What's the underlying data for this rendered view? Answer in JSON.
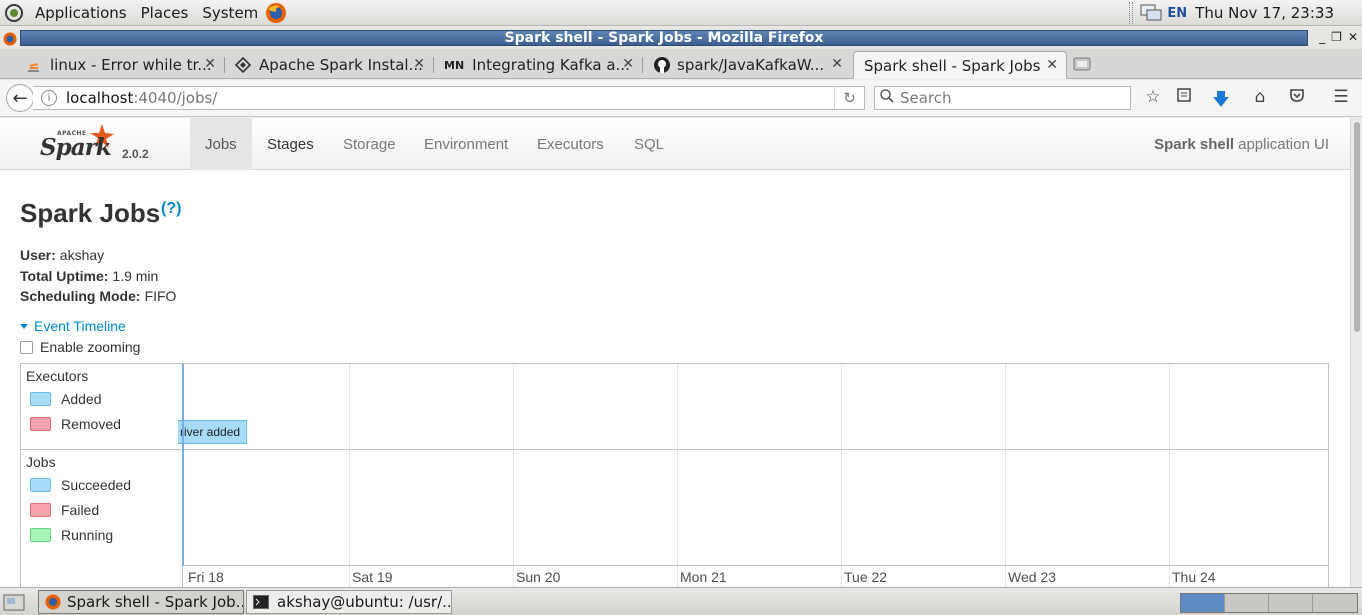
{
  "desktop_panel": {
    "menus": [
      "Applications",
      "Places",
      "System"
    ],
    "keyboard_layout": "EN",
    "clock": "Thu Nov 17, 23:33"
  },
  "window": {
    "title": "Spark shell - Spark Jobs - Mozilla Firefox",
    "controls": [
      "_",
      "❐",
      "✕"
    ]
  },
  "browser": {
    "tabs": [
      {
        "label": "linux - Error while tr...",
        "icon": "stackoverflow-icon"
      },
      {
        "label": "Apache Spark Instal...",
        "icon": "diamond-site-icon"
      },
      {
        "label": "Integrating Kafka a...",
        "icon": "mn-site-icon",
        "favicon_text": "MN"
      },
      {
        "label": "spark/JavaKafkaW...",
        "icon": "github-icon"
      },
      {
        "label": "Spark shell - Spark Jobs",
        "icon": "none",
        "active": true
      }
    ],
    "url_host": "localhost",
    "url_path": ":4040/jobs/",
    "search_placeholder": "Search"
  },
  "spark_ui": {
    "logo_apache": "APACHE",
    "logo_text": "Spark",
    "version": "2.0.2",
    "nav": [
      "Jobs",
      "Stages",
      "Storage",
      "Environment",
      "Executors",
      "SQL"
    ],
    "active_nav": "Jobs",
    "app_name": "Spark shell",
    "app_suffix": "application UI",
    "page_title": "Spark Jobs",
    "help": "(?)",
    "user_label": "User:",
    "user_value": "akshay",
    "uptime_label": "Total Uptime:",
    "uptime_value": "1.9 min",
    "sched_label": "Scheduling Mode:",
    "sched_value": "FIFO",
    "event_timeline": "Event Timeline",
    "enable_zooming": "Enable zooming"
  },
  "timeline": {
    "groups": [
      {
        "title": "Executors",
        "legend": [
          {
            "label": "Added",
            "fill": "#a6dcf6",
            "border": "#6bbbe2"
          },
          {
            "label": "Removed",
            "fill": "#f7a3ae",
            "border": "#e26b7c"
          }
        ]
      },
      {
        "title": "Jobs",
        "legend": [
          {
            "label": "Succeeded",
            "fill": "#a6dcf6",
            "border": "#6bbbe2"
          },
          {
            "label": "Failed",
            "fill": "#f7a3ae",
            "border": "#e26b7c"
          },
          {
            "label": "Running",
            "fill": "#a8f5b8",
            "border": "#6bd27f"
          }
        ]
      }
    ],
    "days": [
      "Fri 18",
      "Sat 19",
      "Sun 20",
      "Mon 21",
      "Tue 22",
      "Wed 23",
      "Thu 24"
    ],
    "event_label": "river added"
  },
  "taskbar": {
    "items": [
      {
        "label": "Spark shell - Spark Job...",
        "icon": "firefox-icon",
        "active": true
      },
      {
        "label": "akshay@ubuntu: /usr/...",
        "icon": "terminal-icon",
        "active": false
      }
    ],
    "workspaces": 4
  }
}
